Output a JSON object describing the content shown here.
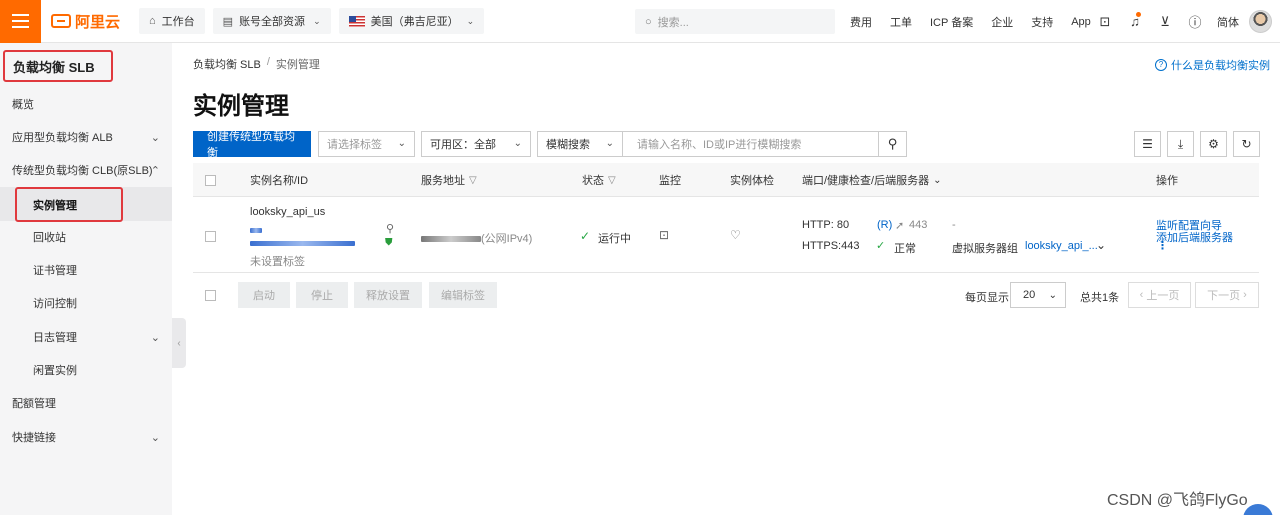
{
  "topbar": {
    "logo_text": "阿里云",
    "workbench": "工作台",
    "account_scope": "账号全部资源",
    "region": "美国（弗吉尼亚）",
    "search_placeholder": "搜索...",
    "nav": [
      "费用",
      "工单",
      "ICP 备案",
      "企业",
      "支持",
      "App"
    ],
    "lang": "简体",
    "icons": [
      "terminal-icon",
      "bell-icon",
      "cart-icon",
      "help-icon"
    ]
  },
  "sidebar": {
    "title": "负载均衡 SLB",
    "items": [
      {
        "label": "概览"
      },
      {
        "label": "应用型负载均衡 ALB"
      },
      {
        "label": "传统型负载均衡 CLB(原SLB)"
      },
      {
        "label": "实例管理"
      },
      {
        "label": "回收站"
      },
      {
        "label": "证书管理"
      },
      {
        "label": "访问控制"
      },
      {
        "label": "日志管理"
      },
      {
        "label": "闲置实例"
      },
      {
        "label": "配额管理"
      },
      {
        "label": "快捷链接"
      }
    ]
  },
  "main": {
    "breadcrumb": [
      "负载均衡 SLB",
      "实例管理"
    ],
    "breadcrumb_sep": "/",
    "help_link": "什么是负载均衡实例",
    "title": "实例管理",
    "create_button": "创建传统型负载均衡",
    "tag_select_placeholder": "请选择标签",
    "zone_label": "可用区：",
    "zone_value": "全部",
    "search_mode": "模糊搜索",
    "search_placeholder": "请输入名称、ID或IP进行模糊搜索"
  },
  "table": {
    "columns": [
      "实例名称/ID",
      "服务地址",
      "状态",
      "监控",
      "实例体检",
      "端口/健康检查/后端服务器",
      "操作"
    ],
    "row": {
      "name": "looksky_api_us",
      "tag": "未设置标签",
      "address_suffix": "(公网IPv4)",
      "status": "运行中",
      "port_http": "HTTP:  80",
      "port_https": "HTTPS:443",
      "rule_badge": "(R)",
      "forward_port": "443",
      "health": "正常",
      "dash": "-",
      "server_group_label": "虚拟服务器组",
      "server_group_value": "looksky_api_...",
      "action_1": "监听配置向导",
      "action_2": "添加后端服务器"
    }
  },
  "footer": {
    "buttons": [
      "启动",
      "停止",
      "释放设置",
      "编辑标签"
    ],
    "per_page_label": "每页显示",
    "per_page_value": "20",
    "total": "总共1条",
    "prev": "上一页",
    "next": "下一页"
  },
  "watermark": "CSDN @飞鸽FlyGo",
  "colors": {
    "brand": "#ff6a00",
    "primary": "#0064c8",
    "highlight_border": "#e0393e",
    "status_ok": "#28a745"
  }
}
